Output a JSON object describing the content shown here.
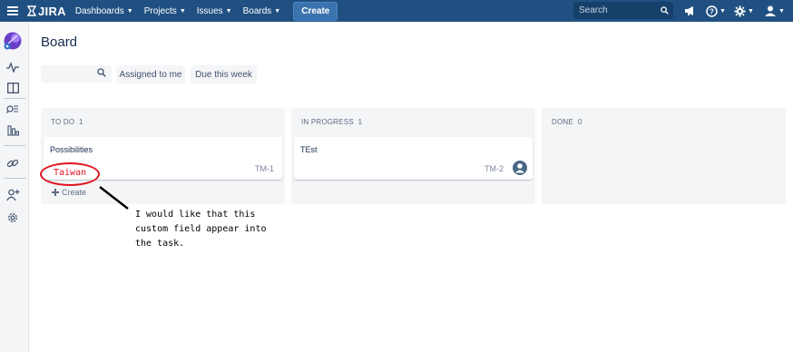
{
  "app": {
    "name": "JIRA",
    "brand_color": "#205081"
  },
  "topbar": {
    "menu_icon": "hamburger-icon",
    "nav": [
      {
        "label": "Dashboards"
      },
      {
        "label": "Projects"
      },
      {
        "label": "Issues"
      },
      {
        "label": "Boards"
      }
    ],
    "create_label": "Create",
    "search_placeholder": "Search",
    "icons": [
      "megaphone-icon",
      "help-icon",
      "gear-icon",
      "user-avatar-icon"
    ]
  },
  "sidebar": {
    "icons": [
      "project-avatar-icon",
      "activity-icon",
      "board-icon",
      "search-issues-icon",
      "reports-icon",
      "link-icon",
      "add-user-icon",
      "settings-icon"
    ]
  },
  "page": {
    "title": "Board"
  },
  "filters": {
    "search_icon": "search-icon",
    "quick": [
      {
        "label": "Assigned to me"
      },
      {
        "label": "Due this week"
      }
    ]
  },
  "columns": [
    {
      "name": "TO DO",
      "count": "1",
      "cards": [
        {
          "summary": "Possibilities",
          "key": "TM-1"
        }
      ],
      "create_label": "Create"
    },
    {
      "name": "IN PROGRESS",
      "count": "1",
      "cards": [
        {
          "summary": "TEst",
          "key": "TM-2",
          "has_avatar": true
        }
      ]
    },
    {
      "name": "DONE",
      "count": "0",
      "cards": []
    }
  ],
  "annotation": {
    "circled_text": "Taiwan",
    "note": "I would like that this\ncustom field appear into\nthe task.",
    "color": "#e0141e"
  }
}
